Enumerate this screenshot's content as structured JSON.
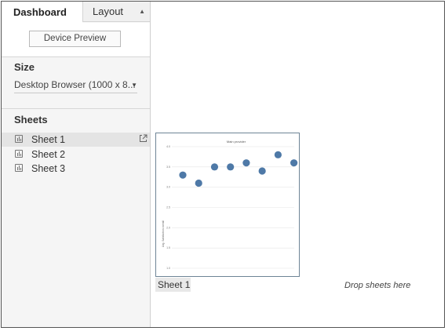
{
  "tabs": {
    "dashboard": "Dashboard",
    "layout": "Layout"
  },
  "device_preview": "Device Preview",
  "size": {
    "title": "Size",
    "value": "Desktop Browser (1000 x 8..."
  },
  "sheets": {
    "title": "Sheets",
    "items": [
      {
        "label": "Sheet 1",
        "selected": true
      },
      {
        "label": "Sheet 2",
        "selected": false
      },
      {
        "label": "Sheet 3",
        "selected": false
      }
    ]
  },
  "canvas": {
    "thumbnail_caption": "Sheet 1",
    "drop_hint": "Drop sheets here"
  },
  "chart_data": {
    "type": "scatter",
    "title": "Main provider",
    "ylabel": "Avg. Satisfaction overall",
    "ylim": [
      1.0,
      4.0
    ],
    "yticks": [
      "4.0",
      "3.5",
      "3.0",
      "2.5",
      "2.0",
      "1.5",
      "1.0"
    ],
    "series": [
      {
        "values": [
          3.3,
          3.1,
          3.5,
          3.5,
          3.6,
          3.4,
          3.8,
          3.6
        ]
      }
    ],
    "color": "#4e79a7",
    "grid": true
  }
}
